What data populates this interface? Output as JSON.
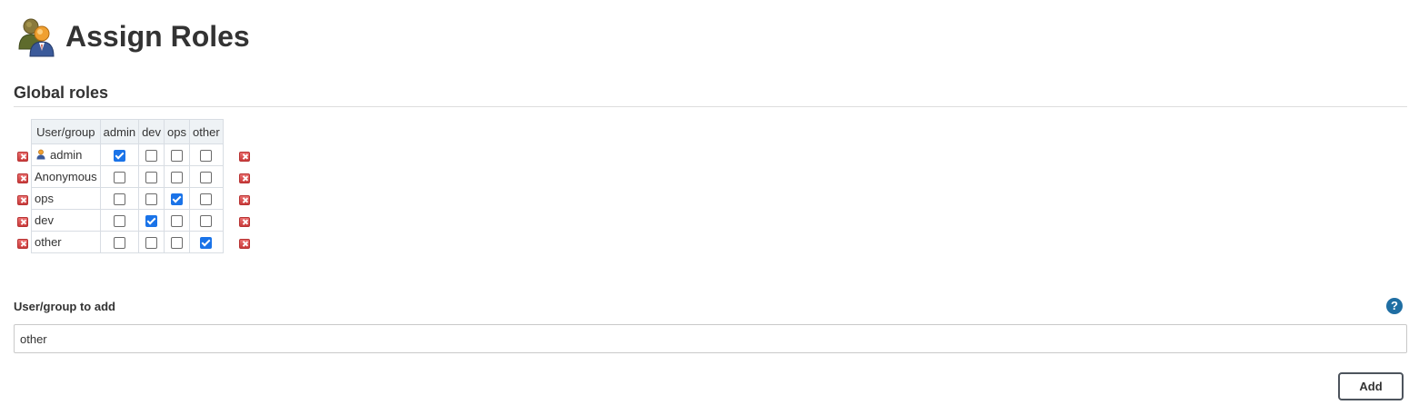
{
  "header": {
    "title": "Assign Roles",
    "icon": "users-group-icon"
  },
  "global_roles": {
    "section_title": "Global roles",
    "columns": [
      "User/group",
      "admin",
      "dev",
      "ops",
      "other"
    ],
    "rows": [
      {
        "name": "admin",
        "has_user_icon": true,
        "checks": [
          true,
          false,
          false,
          false
        ]
      },
      {
        "name": "Anonymous",
        "has_user_icon": false,
        "checks": [
          false,
          false,
          false,
          false
        ]
      },
      {
        "name": "ops",
        "has_user_icon": false,
        "checks": [
          false,
          false,
          true,
          false
        ]
      },
      {
        "name": "dev",
        "has_user_icon": false,
        "checks": [
          false,
          true,
          false,
          false
        ]
      },
      {
        "name": "other",
        "has_user_icon": false,
        "checks": [
          false,
          false,
          false,
          true
        ]
      }
    ],
    "delete_icon": "delete-icon"
  },
  "add_form": {
    "label": "User/group to add",
    "input_value": "other",
    "help_icon": "?",
    "add_label": "Add"
  },
  "colors": {
    "accent": "#1a73e8",
    "help": "#1f6ea3",
    "delete": "#c93a3a",
    "header_bg": "#eef2f5"
  }
}
